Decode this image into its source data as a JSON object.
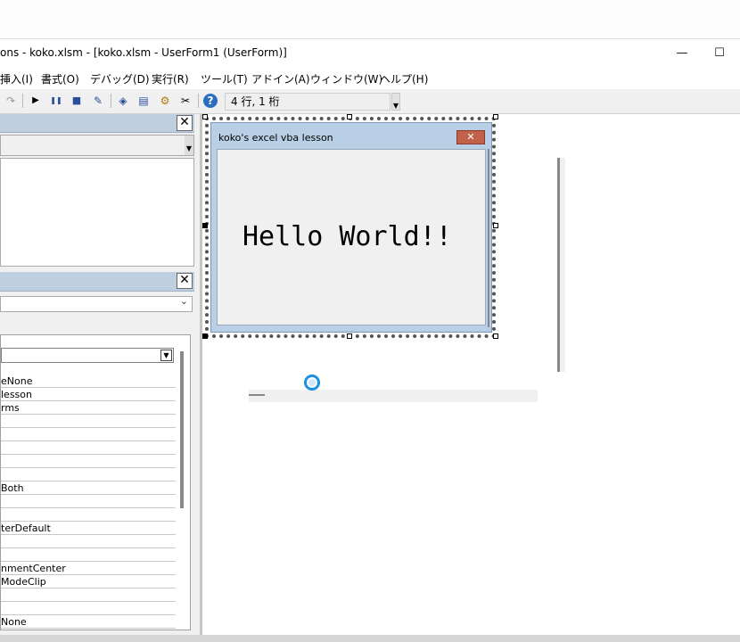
{
  "window": {
    "title": "ons - koko.xlsm - [koko.xlsm - UserForm1 (UserForm)]",
    "minimize_icon": "minimize-icon",
    "maximize_icon": "maximize-icon",
    "minimize_glyph": "—",
    "maximize_glyph": "☐"
  },
  "menu": {
    "items": [
      {
        "label": "挿入(I)"
      },
      {
        "label": "書式(O)"
      },
      {
        "label": "デバッグ(D)"
      },
      {
        "label": "実行(R)"
      },
      {
        "label": "ツール(T)"
      },
      {
        "label": "アドイン(A)"
      },
      {
        "label": "ウィンドウ(W)"
      },
      {
        "label": "ヘルプ(H)"
      }
    ]
  },
  "toolbar": {
    "redo_icon": "↷",
    "run_icon": "▶",
    "pause_icon": "❚❚",
    "stop_icon": "■",
    "design_icon": "✎",
    "project_icon": "◈",
    "properties_icon": "▤",
    "object_icon": "⚙",
    "toolbox_icon": "✂",
    "help_icon": "?",
    "position_text": "4 行, 1 桁"
  },
  "project_panel": {
    "close_glyph": "✕"
  },
  "properties_panel": {
    "close_glyph": "✕",
    "combo_chevron": "⌄",
    "rows": [
      {
        "value": ""
      },
      {
        "value": "eNone"
      },
      {
        "value": "lesson"
      },
      {
        "value": "rms"
      },
      {
        "value": ""
      },
      {
        "value": ""
      },
      {
        "value": ""
      },
      {
        "value": ""
      },
      {
        "value": ""
      },
      {
        "value": "Both"
      },
      {
        "value": ""
      },
      {
        "value": ""
      },
      {
        "value": "terDefault"
      },
      {
        "value": ""
      },
      {
        "value": ""
      },
      {
        "value": "nmentCenter"
      },
      {
        "value": "ModeClip"
      },
      {
        "value": ""
      },
      {
        "value": ""
      },
      {
        "value": "None"
      }
    ]
  },
  "userform": {
    "caption": "koko's excel vba lesson",
    "close_glyph": "✕",
    "label_text": "Hello World!!"
  },
  "colors": {
    "form_titlebar": "#b8cfe6",
    "form_close": "#c0634a",
    "panel_header": "#bfcfe0",
    "busy_ring": "#1e90e0"
  }
}
